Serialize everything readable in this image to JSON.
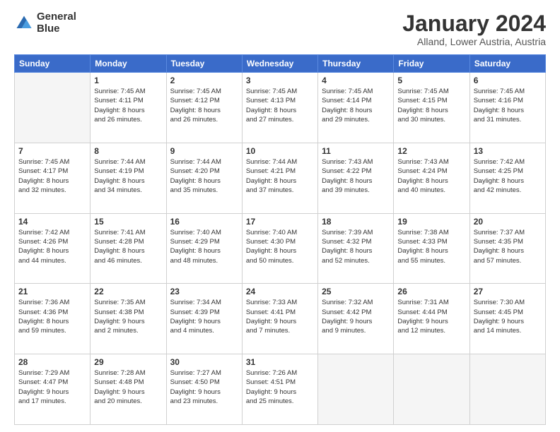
{
  "header": {
    "logo_line1": "General",
    "logo_line2": "Blue",
    "month": "January 2024",
    "location": "Alland, Lower Austria, Austria"
  },
  "weekdays": [
    "Sunday",
    "Monday",
    "Tuesday",
    "Wednesday",
    "Thursday",
    "Friday",
    "Saturday"
  ],
  "weeks": [
    [
      {
        "day": "",
        "text": ""
      },
      {
        "day": "1",
        "text": "Sunrise: 7:45 AM\nSunset: 4:11 PM\nDaylight: 8 hours\nand 26 minutes."
      },
      {
        "day": "2",
        "text": "Sunrise: 7:45 AM\nSunset: 4:12 PM\nDaylight: 8 hours\nand 26 minutes."
      },
      {
        "day": "3",
        "text": "Sunrise: 7:45 AM\nSunset: 4:13 PM\nDaylight: 8 hours\nand 27 minutes."
      },
      {
        "day": "4",
        "text": "Sunrise: 7:45 AM\nSunset: 4:14 PM\nDaylight: 8 hours\nand 29 minutes."
      },
      {
        "day": "5",
        "text": "Sunrise: 7:45 AM\nSunset: 4:15 PM\nDaylight: 8 hours\nand 30 minutes."
      },
      {
        "day": "6",
        "text": "Sunrise: 7:45 AM\nSunset: 4:16 PM\nDaylight: 8 hours\nand 31 minutes."
      }
    ],
    [
      {
        "day": "7",
        "text": "Sunrise: 7:45 AM\nSunset: 4:17 PM\nDaylight: 8 hours\nand 32 minutes."
      },
      {
        "day": "8",
        "text": "Sunrise: 7:44 AM\nSunset: 4:19 PM\nDaylight: 8 hours\nand 34 minutes."
      },
      {
        "day": "9",
        "text": "Sunrise: 7:44 AM\nSunset: 4:20 PM\nDaylight: 8 hours\nand 35 minutes."
      },
      {
        "day": "10",
        "text": "Sunrise: 7:44 AM\nSunset: 4:21 PM\nDaylight: 8 hours\nand 37 minutes."
      },
      {
        "day": "11",
        "text": "Sunrise: 7:43 AM\nSunset: 4:22 PM\nDaylight: 8 hours\nand 39 minutes."
      },
      {
        "day": "12",
        "text": "Sunrise: 7:43 AM\nSunset: 4:24 PM\nDaylight: 8 hours\nand 40 minutes."
      },
      {
        "day": "13",
        "text": "Sunrise: 7:42 AM\nSunset: 4:25 PM\nDaylight: 8 hours\nand 42 minutes."
      }
    ],
    [
      {
        "day": "14",
        "text": "Sunrise: 7:42 AM\nSunset: 4:26 PM\nDaylight: 8 hours\nand 44 minutes."
      },
      {
        "day": "15",
        "text": "Sunrise: 7:41 AM\nSunset: 4:28 PM\nDaylight: 8 hours\nand 46 minutes."
      },
      {
        "day": "16",
        "text": "Sunrise: 7:40 AM\nSunset: 4:29 PM\nDaylight: 8 hours\nand 48 minutes."
      },
      {
        "day": "17",
        "text": "Sunrise: 7:40 AM\nSunset: 4:30 PM\nDaylight: 8 hours\nand 50 minutes."
      },
      {
        "day": "18",
        "text": "Sunrise: 7:39 AM\nSunset: 4:32 PM\nDaylight: 8 hours\nand 52 minutes."
      },
      {
        "day": "19",
        "text": "Sunrise: 7:38 AM\nSunset: 4:33 PM\nDaylight: 8 hours\nand 55 minutes."
      },
      {
        "day": "20",
        "text": "Sunrise: 7:37 AM\nSunset: 4:35 PM\nDaylight: 8 hours\nand 57 minutes."
      }
    ],
    [
      {
        "day": "21",
        "text": "Sunrise: 7:36 AM\nSunset: 4:36 PM\nDaylight: 8 hours\nand 59 minutes."
      },
      {
        "day": "22",
        "text": "Sunrise: 7:35 AM\nSunset: 4:38 PM\nDaylight: 9 hours\nand 2 minutes."
      },
      {
        "day": "23",
        "text": "Sunrise: 7:34 AM\nSunset: 4:39 PM\nDaylight: 9 hours\nand 4 minutes."
      },
      {
        "day": "24",
        "text": "Sunrise: 7:33 AM\nSunset: 4:41 PM\nDaylight: 9 hours\nand 7 minutes."
      },
      {
        "day": "25",
        "text": "Sunrise: 7:32 AM\nSunset: 4:42 PM\nDaylight: 9 hours\nand 9 minutes."
      },
      {
        "day": "26",
        "text": "Sunrise: 7:31 AM\nSunset: 4:44 PM\nDaylight: 9 hours\nand 12 minutes."
      },
      {
        "day": "27",
        "text": "Sunrise: 7:30 AM\nSunset: 4:45 PM\nDaylight: 9 hours\nand 14 minutes."
      }
    ],
    [
      {
        "day": "28",
        "text": "Sunrise: 7:29 AM\nSunset: 4:47 PM\nDaylight: 9 hours\nand 17 minutes."
      },
      {
        "day": "29",
        "text": "Sunrise: 7:28 AM\nSunset: 4:48 PM\nDaylight: 9 hours\nand 20 minutes."
      },
      {
        "day": "30",
        "text": "Sunrise: 7:27 AM\nSunset: 4:50 PM\nDaylight: 9 hours\nand 23 minutes."
      },
      {
        "day": "31",
        "text": "Sunrise: 7:26 AM\nSunset: 4:51 PM\nDaylight: 9 hours\nand 25 minutes."
      },
      {
        "day": "",
        "text": ""
      },
      {
        "day": "",
        "text": ""
      },
      {
        "day": "",
        "text": ""
      }
    ]
  ]
}
